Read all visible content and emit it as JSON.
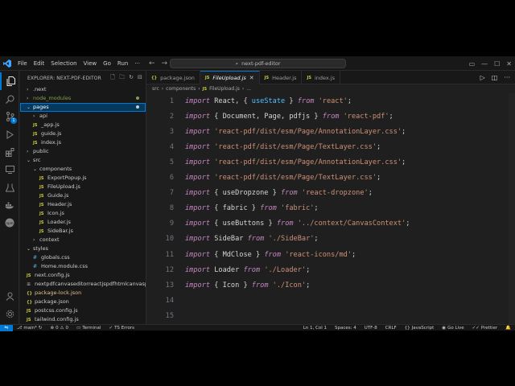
{
  "titlebar": {
    "menu": [
      "File",
      "Edit",
      "Selection",
      "View",
      "Go",
      "Run"
    ],
    "more": "···",
    "search_text": "next-pdf-editor"
  },
  "explorer": {
    "title": "EXPLORER: NEXT-PDF-EDITOR",
    "tree": [
      {
        "label": ".next",
        "depth": 0,
        "kind": "folder",
        "open": false
      },
      {
        "label": "node_modules",
        "depth": 0,
        "kind": "folder",
        "open": false,
        "style": "modules"
      },
      {
        "label": "pages",
        "depth": 0,
        "kind": "folder",
        "open": true,
        "selected": true,
        "style": "pages"
      },
      {
        "label": "api",
        "depth": 1,
        "kind": "folder",
        "open": false
      },
      {
        "label": "_app.js",
        "depth": 1,
        "kind": "js"
      },
      {
        "label": "guide.js",
        "depth": 1,
        "kind": "js"
      },
      {
        "label": "index.js",
        "depth": 1,
        "kind": "js"
      },
      {
        "label": "public",
        "depth": 0,
        "kind": "folder",
        "open": false
      },
      {
        "label": "src",
        "depth": 0,
        "kind": "folder",
        "open": true
      },
      {
        "label": "components",
        "depth": 1,
        "kind": "folder",
        "open": true
      },
      {
        "label": "ExportPopup.js",
        "depth": 2,
        "kind": "js"
      },
      {
        "label": "FileUpload.js",
        "depth": 2,
        "kind": "js"
      },
      {
        "label": "Guide.js",
        "depth": 2,
        "kind": "js"
      },
      {
        "label": "Header.js",
        "depth": 2,
        "kind": "js"
      },
      {
        "label": "Icon.js",
        "depth": 2,
        "kind": "js"
      },
      {
        "label": "Loader.js",
        "depth": 2,
        "kind": "js"
      },
      {
        "label": "SideBar.js",
        "depth": 2,
        "kind": "js"
      },
      {
        "label": "context",
        "depth": 1,
        "kind": "folder",
        "open": false
      },
      {
        "label": "styles",
        "depth": 0,
        "kind": "folder",
        "open": true
      },
      {
        "label": "globals.css",
        "depth": 1,
        "kind": "css"
      },
      {
        "label": "Home.module.css",
        "depth": 1,
        "kind": "css"
      },
      {
        "label": "next.config.js",
        "depth": 0,
        "kind": "js"
      },
      {
        "label": "nextpdfcanvaseditorreactjspdfhtmlcanvasproje...",
        "depth": 0,
        "kind": "txt"
      },
      {
        "label": "package-lock.json",
        "depth": 0,
        "kind": "json",
        "style": "lock"
      },
      {
        "label": "package.json",
        "depth": 0,
        "kind": "json"
      },
      {
        "label": "postcss.config.js",
        "depth": 0,
        "kind": "js"
      },
      {
        "label": "tailwind.config.js",
        "depth": 0,
        "kind": "js"
      }
    ]
  },
  "tabs": [
    {
      "label": "package.json",
      "kind": "json",
      "active": false
    },
    {
      "label": "FileUpload.js",
      "kind": "js",
      "active": true
    },
    {
      "label": "Header.js",
      "kind": "js",
      "active": false
    },
    {
      "label": "index.js",
      "kind": "js",
      "active": false
    }
  ],
  "breadcrumb": [
    "src",
    "components",
    "FileUpload.js",
    "..."
  ],
  "code": [
    {
      "n": "1",
      "tokens": [
        [
          "kw",
          "import"
        ],
        [
          "pn",
          " React, { "
        ],
        [
          "fn",
          "useState"
        ],
        [
          "pn",
          " } "
        ],
        [
          "kw",
          "from"
        ],
        [
          "st",
          " 'react'"
        ],
        [
          "pn",
          ";"
        ]
      ]
    },
    {
      "n": "2",
      "tokens": [
        [
          "kw",
          "import"
        ],
        [
          "pn",
          " { Document, Page, pdfjs } "
        ],
        [
          "kw",
          "from"
        ],
        [
          "st",
          " 'react-pdf'"
        ],
        [
          "pn",
          ";"
        ]
      ]
    },
    {
      "n": "3",
      "tokens": [
        [
          "kw",
          "import"
        ],
        [
          "st",
          " 'react-pdf/dist/esm/Page/AnnotationLayer.css'"
        ],
        [
          "pn",
          ";"
        ]
      ]
    },
    {
      "n": "4",
      "tokens": [
        [
          "kw",
          "import"
        ],
        [
          "st",
          " 'react-pdf/dist/esm/Page/TextLayer.css'"
        ],
        [
          "pn",
          ";"
        ]
      ]
    },
    {
      "n": "5",
      "tokens": [
        [
          "kw",
          "import"
        ],
        [
          "st",
          " 'react-pdf/dist/esm/Page/AnnotationLayer.css'"
        ],
        [
          "pn",
          ";"
        ]
      ]
    },
    {
      "n": "6",
      "tokens": [
        [
          "kw",
          "import"
        ],
        [
          "st",
          " 'react-pdf/dist/esm/Page/TextLayer.css'"
        ],
        [
          "pn",
          ";"
        ]
      ]
    },
    {
      "n": "7",
      "tokens": [
        [
          "kw",
          "import"
        ],
        [
          "pn",
          " { useDropzone } "
        ],
        [
          "kw",
          "from"
        ],
        [
          "st",
          " 'react-dropzone'"
        ],
        [
          "pn",
          ";"
        ]
      ]
    },
    {
      "n": "8",
      "tokens": [
        [
          "kw",
          "import"
        ],
        [
          "pn",
          " { fabric } "
        ],
        [
          "kw",
          "from"
        ],
        [
          "st",
          " 'fabric'"
        ],
        [
          "pn",
          ";"
        ]
      ]
    },
    {
      "n": "9",
      "tokens": [
        [
          "kw",
          "import"
        ],
        [
          "pn",
          " { useButtons } "
        ],
        [
          "kw",
          "from"
        ],
        [
          "st",
          " '../context/CanvasContext'"
        ],
        [
          "pn",
          ";"
        ]
      ]
    },
    {
      "n": "10",
      "tokens": [
        [
          "kw",
          "import"
        ],
        [
          "pn",
          " SideBar "
        ],
        [
          "kw",
          "from"
        ],
        [
          "st",
          " './SideBar'"
        ],
        [
          "pn",
          ";"
        ]
      ]
    },
    {
      "n": "11",
      "tokens": [
        [
          "kw",
          "import"
        ],
        [
          "pn",
          " { MdClose } "
        ],
        [
          "kw",
          "from"
        ],
        [
          "st",
          " 'react-icons/md'"
        ],
        [
          "pn",
          ";"
        ]
      ]
    },
    {
      "n": "12",
      "tokens": [
        [
          "kw",
          "import"
        ],
        [
          "pn",
          " Loader "
        ],
        [
          "kw",
          "from"
        ],
        [
          "st",
          " './Loader'"
        ],
        [
          "pn",
          ";"
        ]
      ]
    },
    {
      "n": "13",
      "tokens": [
        [
          "kw",
          "import"
        ],
        [
          "pn",
          " { Icon } "
        ],
        [
          "kw",
          "from"
        ],
        [
          "st",
          " './Icon'"
        ],
        [
          "pn",
          ";"
        ]
      ]
    },
    {
      "n": "14",
      "tokens": []
    },
    {
      "n": "15",
      "tokens": []
    }
  ],
  "status": {
    "branch": "main*",
    "errors": "0",
    "warnings": "0",
    "terminal": "Terminal",
    "ts_errors": "TS Errors",
    "position": "Ln 1, Col 1",
    "spaces": "Spaces: 4",
    "encoding": "UTF-8",
    "eol": "CRLF",
    "language": "JavaScript",
    "golive": "Go Live",
    "prettier": "Prettier"
  },
  "colors": {
    "accent": "#0078d4",
    "keyword": "#c586c0",
    "string": "#ce9178",
    "function": "#4fc1ff"
  }
}
